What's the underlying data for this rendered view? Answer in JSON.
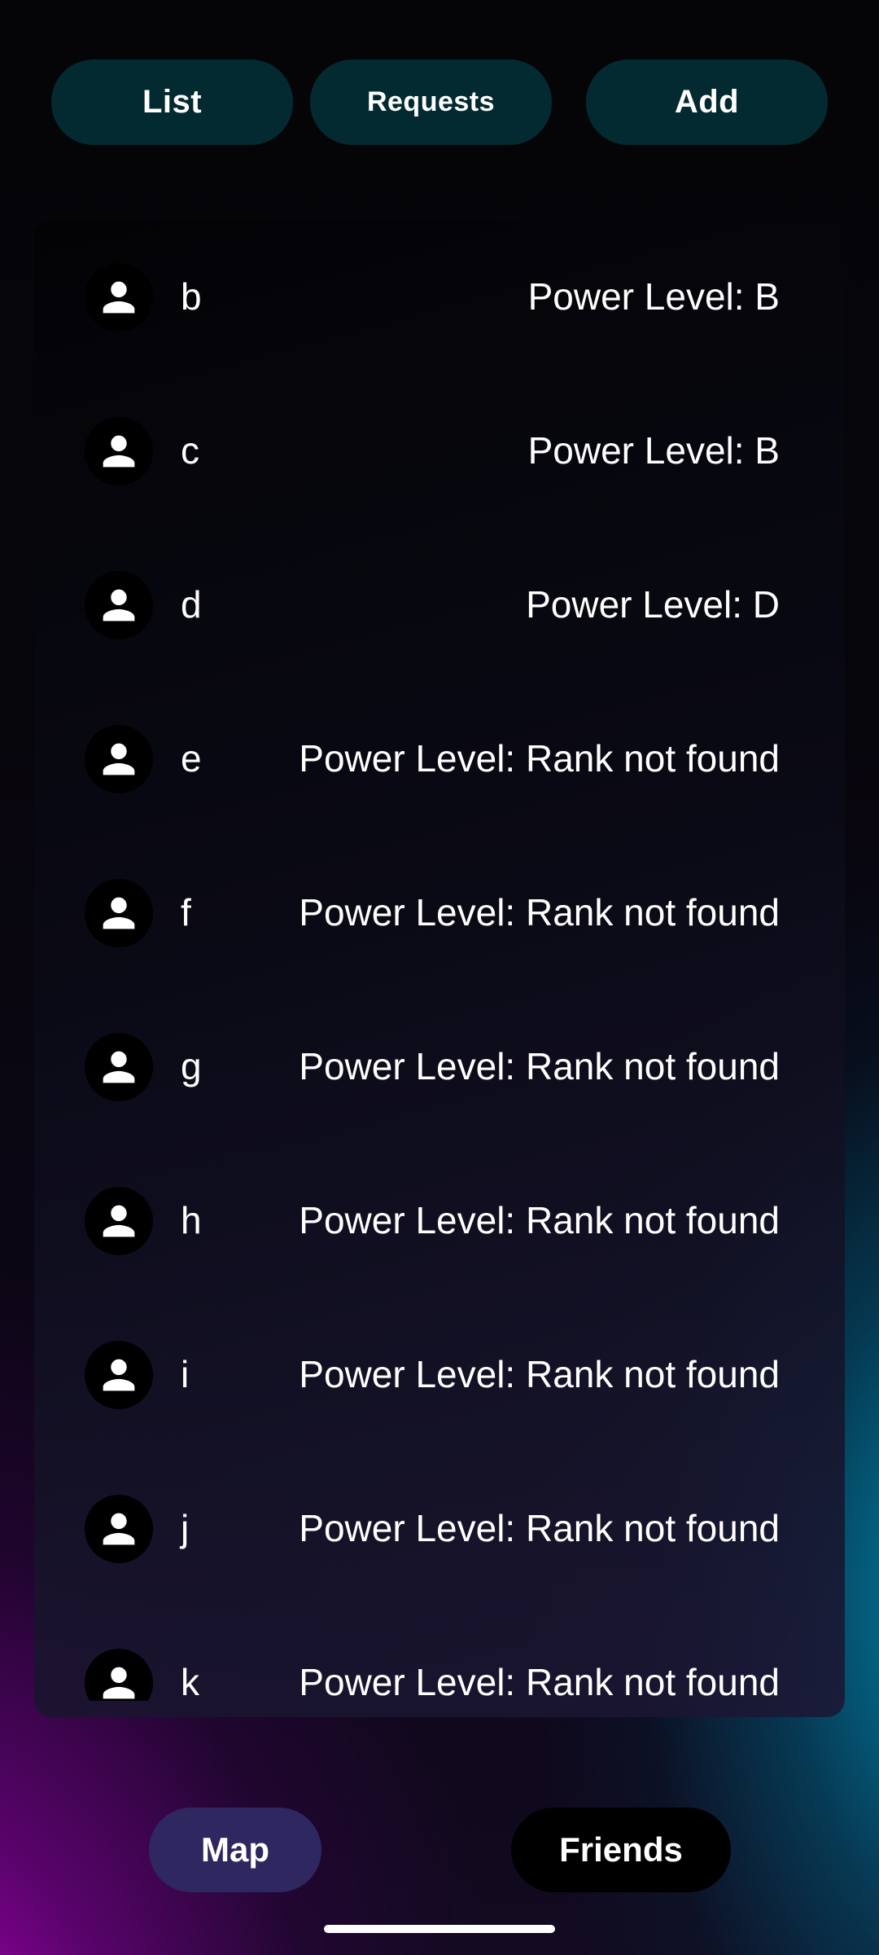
{
  "top_tabs": {
    "list_label": "List",
    "requests_label": "Requests",
    "add_label": "Add"
  },
  "friends": [
    {
      "name": "b",
      "power_level": "Power Level: B"
    },
    {
      "name": "c",
      "power_level": "Power Level: B"
    },
    {
      "name": "d",
      "power_level": "Power Level: D"
    },
    {
      "name": "e",
      "power_level": "Power Level: Rank not found"
    },
    {
      "name": "f",
      "power_level": "Power Level: Rank not found"
    },
    {
      "name": "g",
      "power_level": "Power Level: Rank not found"
    },
    {
      "name": "h",
      "power_level": "Power Level: Rank not found"
    },
    {
      "name": "i",
      "power_level": "Power Level: Rank not found"
    },
    {
      "name": "j",
      "power_level": "Power Level: Rank not found"
    },
    {
      "name": "k",
      "power_level": "Power Level: Rank not found"
    }
  ],
  "icons": {
    "avatar": "person-icon"
  },
  "bottom_nav": {
    "map_label": "Map",
    "friends_label": "Friends"
  },
  "colors": {
    "tab_pill": "#032a30",
    "map_pill": "#2e2760",
    "friends_pill": "#000000",
    "glow_magenta": "#be00c8",
    "glow_cyan": "#0096be"
  }
}
